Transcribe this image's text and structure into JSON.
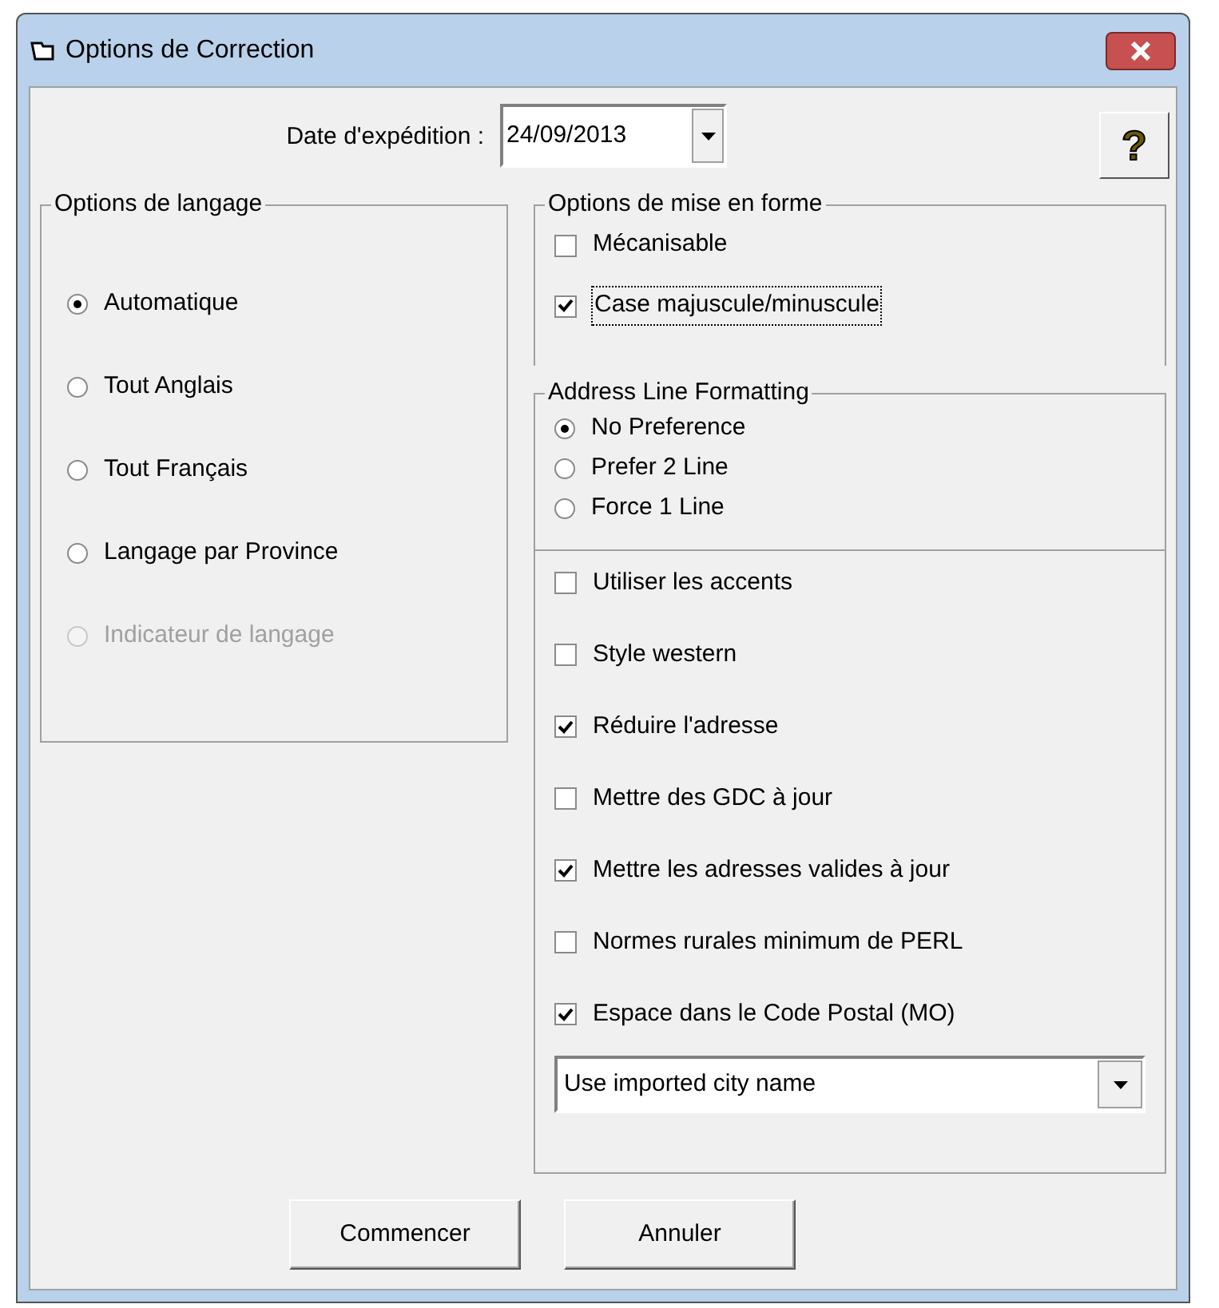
{
  "window": {
    "title": "Options de Correction"
  },
  "shipping_date": {
    "label": "Date d'expédition :",
    "value": "24/09/2013"
  },
  "help_button": {
    "label": "?"
  },
  "language_options": {
    "legend": "Options de langage",
    "options": [
      {
        "label": "Automatique",
        "selected": true,
        "disabled": false
      },
      {
        "label": "Tout Anglais",
        "selected": false,
        "disabled": false
      },
      {
        "label": "Tout Français",
        "selected": false,
        "disabled": false
      },
      {
        "label": "Langage par Province",
        "selected": false,
        "disabled": false
      },
      {
        "label": "Indicateur de langage",
        "selected": false,
        "disabled": true
      }
    ]
  },
  "format_options": {
    "legend": "Options de mise en forme",
    "options": [
      {
        "label": "Mécanisable",
        "checked": false,
        "focused": false
      },
      {
        "label": "Case majuscule/minuscule",
        "checked": true,
        "focused": true
      }
    ]
  },
  "address_line_formatting": {
    "legend": "Address Line Formatting",
    "options": [
      {
        "label": "No Preference",
        "selected": true
      },
      {
        "label": "Prefer 2 Line",
        "selected": false
      },
      {
        "label": "Force 1 Line",
        "selected": false
      }
    ]
  },
  "other_options": {
    "options": [
      {
        "label": "Utiliser les accents",
        "checked": false
      },
      {
        "label": "Style western",
        "checked": false
      },
      {
        "label": "Réduire l'adresse",
        "checked": true
      },
      {
        "label": "Mettre des GDC à jour",
        "checked": false
      },
      {
        "label": "Mettre les adresses valides à jour",
        "checked": true
      },
      {
        "label": "Normes rurales minimum de PERL",
        "checked": false
      },
      {
        "label": "Espace dans le Code Postal (MO)",
        "checked": true
      }
    ],
    "city_name": {
      "value": "Use imported city name"
    }
  },
  "buttons": [
    {
      "label": "Commencer"
    },
    {
      "label": "Annuler"
    }
  ]
}
